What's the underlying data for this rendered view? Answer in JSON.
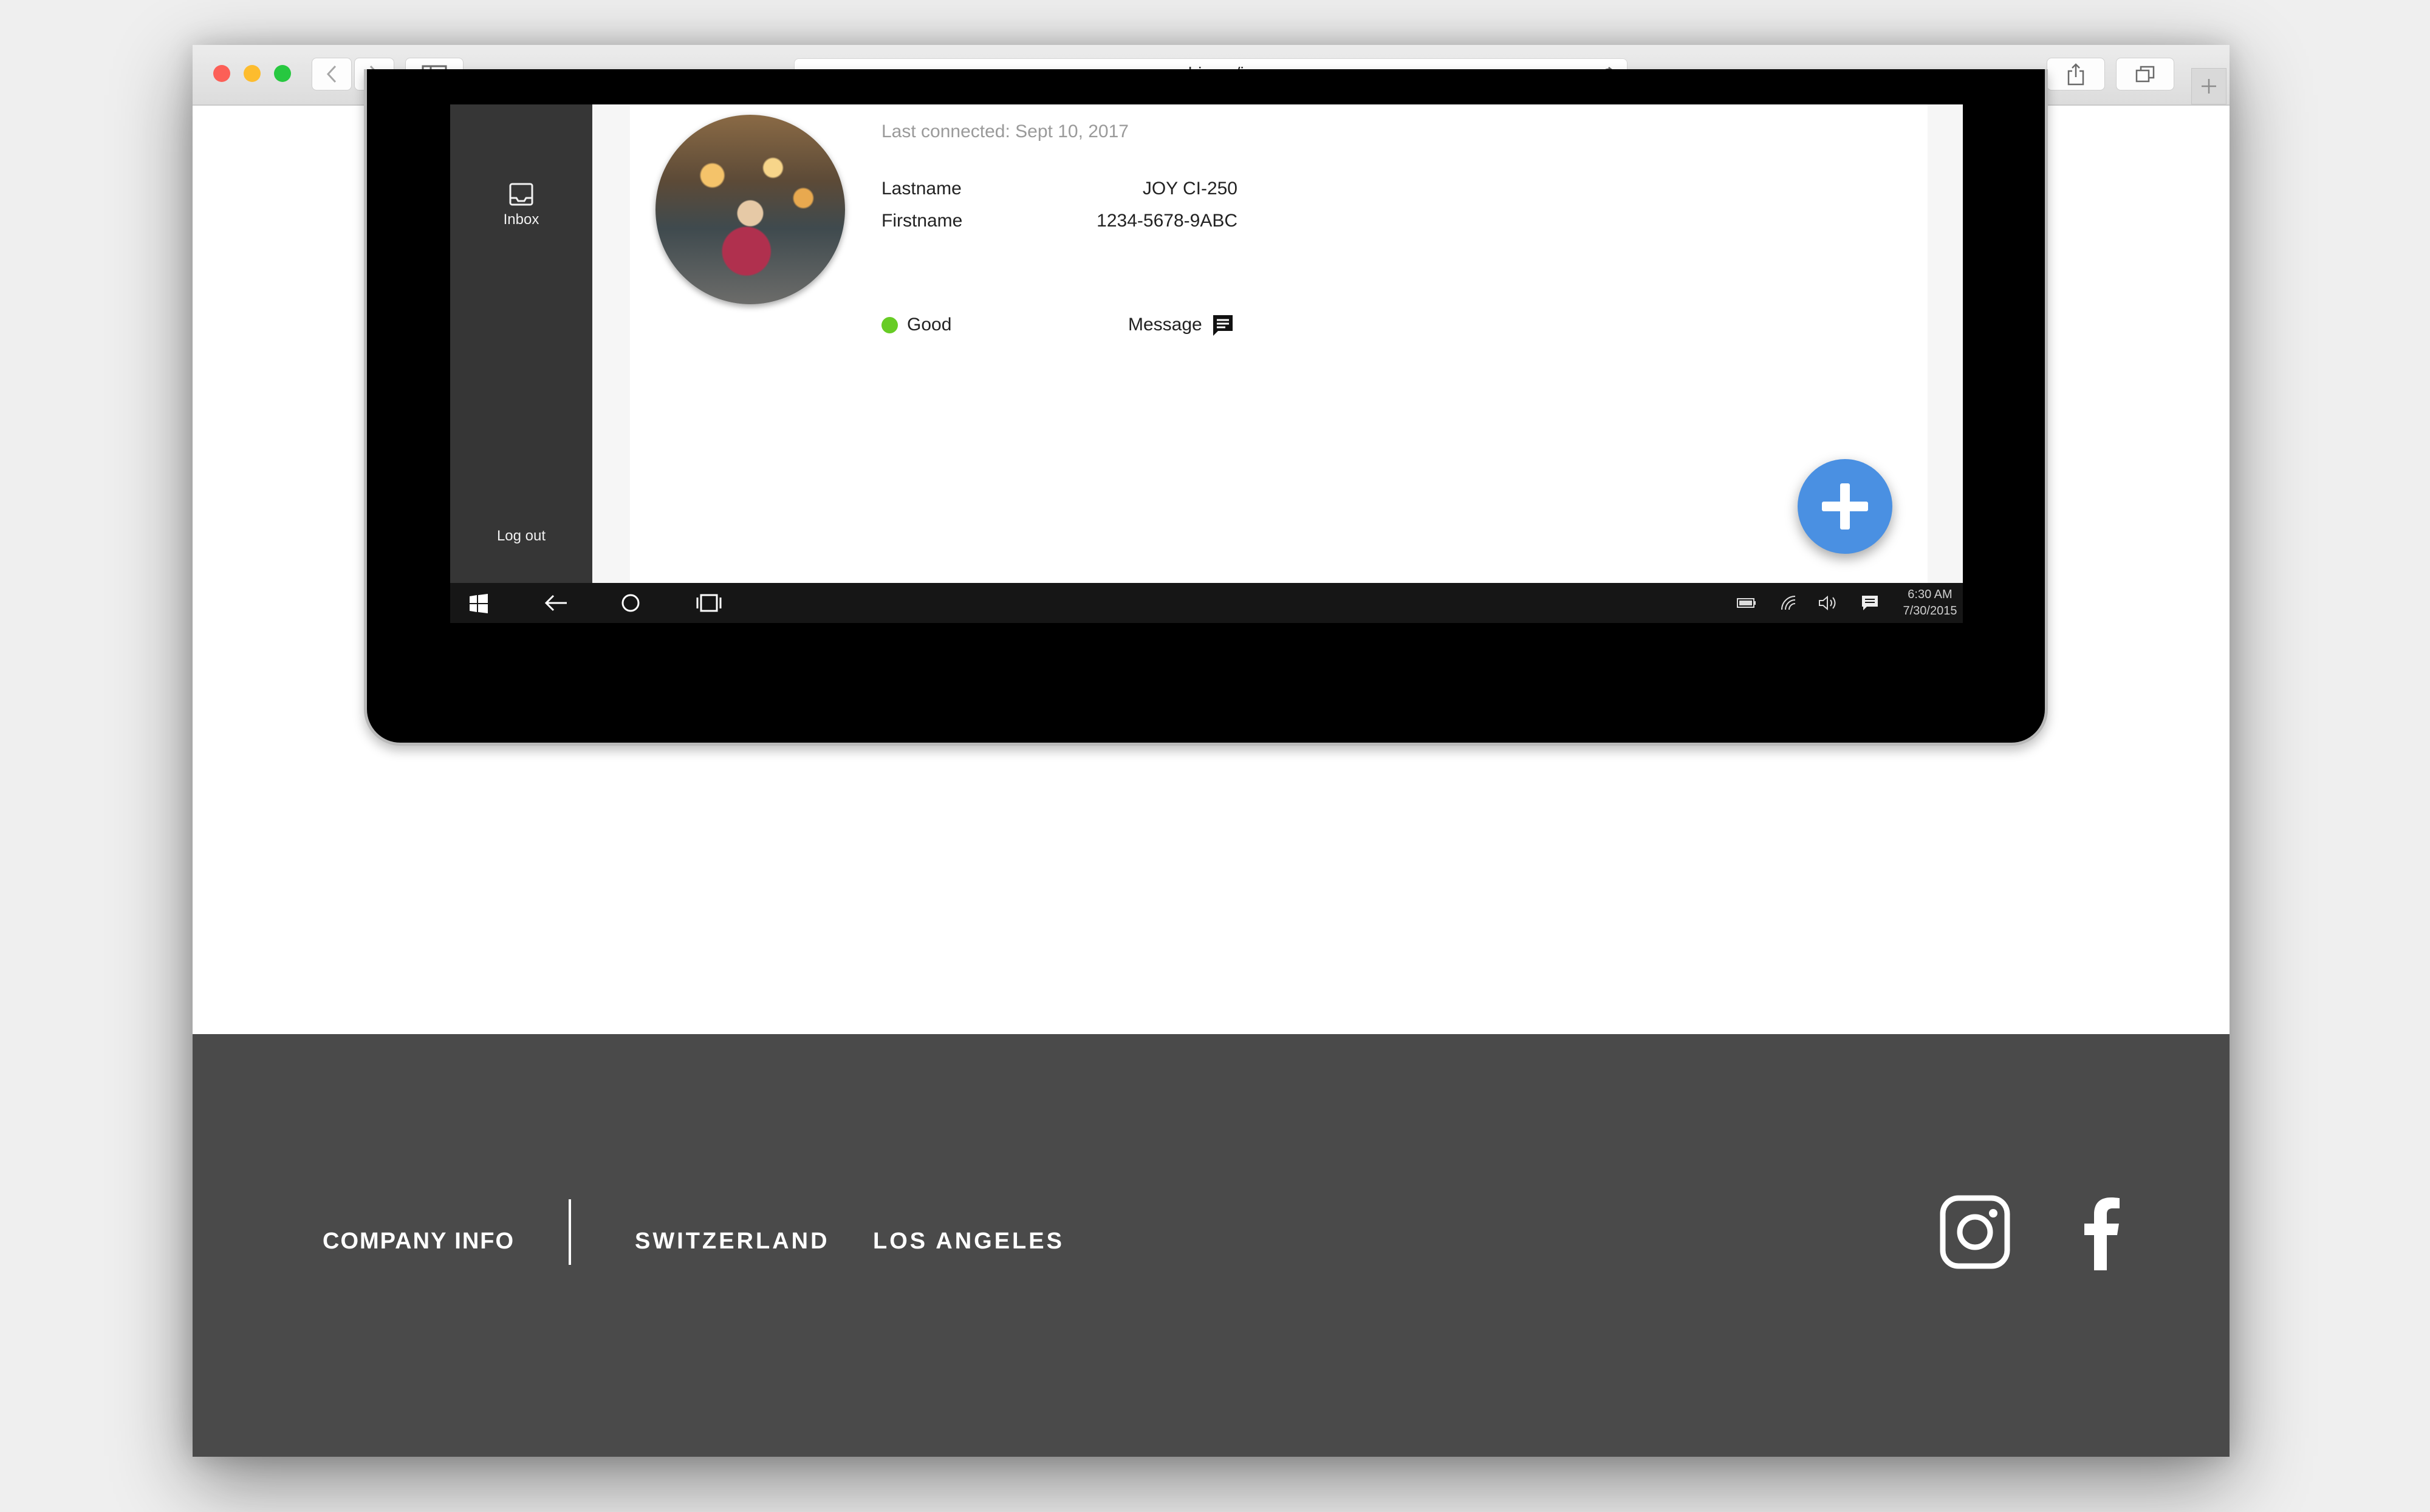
{
  "browser": {
    "url": "neubio.co/joy",
    "traffic_lights": {
      "close": "#fc5f57",
      "minimize": "#fdbc2e",
      "zoom": "#27c840"
    }
  },
  "tablet_app": {
    "sidebar": {
      "inbox_label": "Inbox",
      "logout_label": "Log out"
    },
    "profile": {
      "last_connected": "Last connected: Sept 10, 2017",
      "lastname_label": "Lastname",
      "lastname_value": "JOY CI-250",
      "firstname_label": "Firstname",
      "firstname_value": "1234-5678-9ABC",
      "status_label": "Good",
      "status_color": "#67cc25",
      "message_label": "Message"
    },
    "fab": {
      "icon": "plus-icon",
      "color": "#4a90e2"
    },
    "taskbar": {
      "time": "6:30 AM",
      "date": "7/30/2015"
    }
  },
  "footer": {
    "company_info": "COMPANY INFO",
    "links": [
      "SWITZERLAND",
      "LOS ANGELES"
    ],
    "social": [
      "instagram-icon",
      "facebook-icon"
    ],
    "background": "#4a4a4a"
  }
}
